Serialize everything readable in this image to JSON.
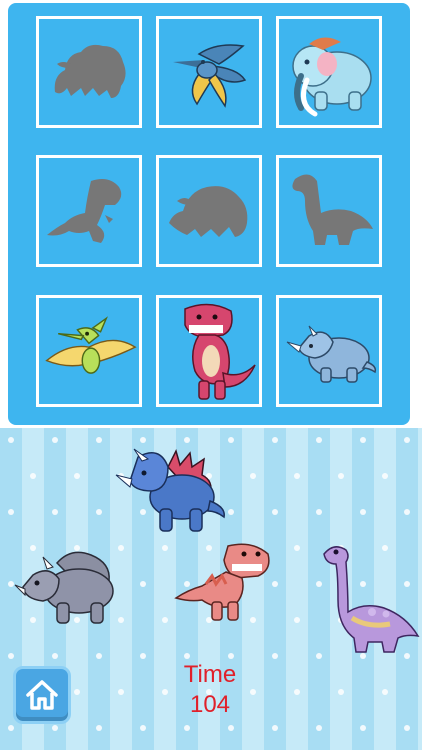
{
  "board": {
    "slots": [
      {
        "id": "slot-1",
        "state": "silhouette",
        "dino": "triceratops"
      },
      {
        "id": "slot-2",
        "state": "placed",
        "dino": "pterodactyl-blue"
      },
      {
        "id": "slot-3",
        "state": "placed",
        "dino": "mammoth"
      },
      {
        "id": "slot-4",
        "state": "silhouette",
        "dino": "trex"
      },
      {
        "id": "slot-5",
        "state": "silhouette",
        "dino": "stegosaurus"
      },
      {
        "id": "slot-6",
        "state": "silhouette",
        "dino": "brontosaurus"
      },
      {
        "id": "slot-7",
        "state": "placed",
        "dino": "pterodactyl-yellow"
      },
      {
        "id": "slot-8",
        "state": "placed",
        "dino": "trex-pink"
      },
      {
        "id": "slot-9",
        "state": "placed",
        "dino": "triceratops-light"
      }
    ]
  },
  "tray": {
    "pieces": [
      "triceratops-blue",
      "triceratops-gray",
      "trex-salmon",
      "brontosaurus-purple"
    ]
  },
  "timer": {
    "label": "Time",
    "value": "104"
  },
  "home_button": {
    "icon": "home-icon"
  },
  "colors": {
    "board": "#3eb5ef",
    "silhouette": "#777777",
    "timer_text": "#e0202a",
    "stripe_dark": "#a8ddf3",
    "stripe_light": "#c6eaf8"
  }
}
